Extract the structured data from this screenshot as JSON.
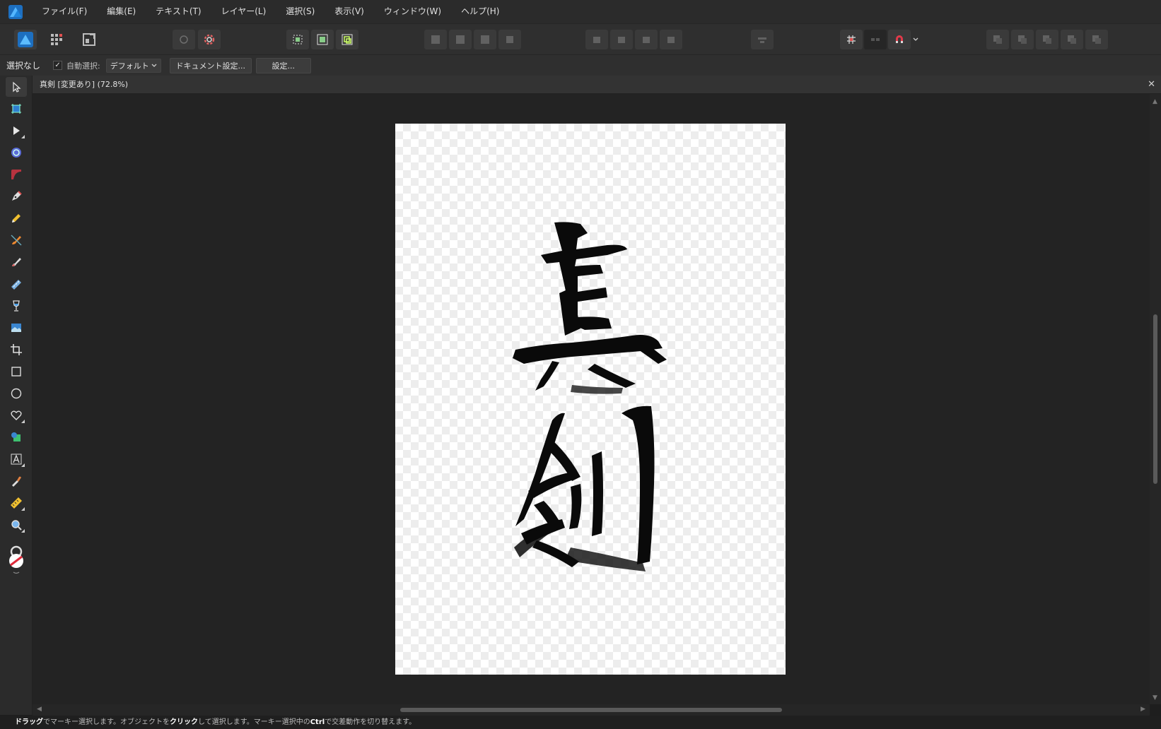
{
  "app": {
    "logo_icon": "affinity-designer-logo-icon",
    "accent": "#2e8fe0"
  },
  "menu": [
    {
      "id": "file",
      "label": "ファイル(F)"
    },
    {
      "id": "edit",
      "label": "編集(E)"
    },
    {
      "id": "text",
      "label": "テキスト(T)"
    },
    {
      "id": "layer",
      "label": "レイヤー(L)"
    },
    {
      "id": "select",
      "label": "選択(S)"
    },
    {
      "id": "view",
      "label": "表示(V)"
    },
    {
      "id": "window",
      "label": "ウィンドウ(W)"
    },
    {
      "id": "help",
      "label": "ヘルプ(H)"
    }
  ],
  "context": {
    "selection_status": "選択なし",
    "auto_select_checked": true,
    "auto_select_label": "自動選択:",
    "auto_select_value": "デフォルト",
    "document_setup_label": "ドキュメント設定...",
    "settings_label": "設定..."
  },
  "document": {
    "title": "真剣 [変更あり] (72.8%)",
    "close_glyph": "✕",
    "artwork_characters": [
      "真",
      "剣"
    ]
  },
  "status": {
    "drag": "ドラッグ",
    "t1": "でマーキー選択します。オブジェクトを",
    "click": "クリック",
    "t2": "して選択します。マーキー選択中の",
    "ctrl": "Ctrl",
    "t3": "で交差動作を切り替えます。"
  }
}
